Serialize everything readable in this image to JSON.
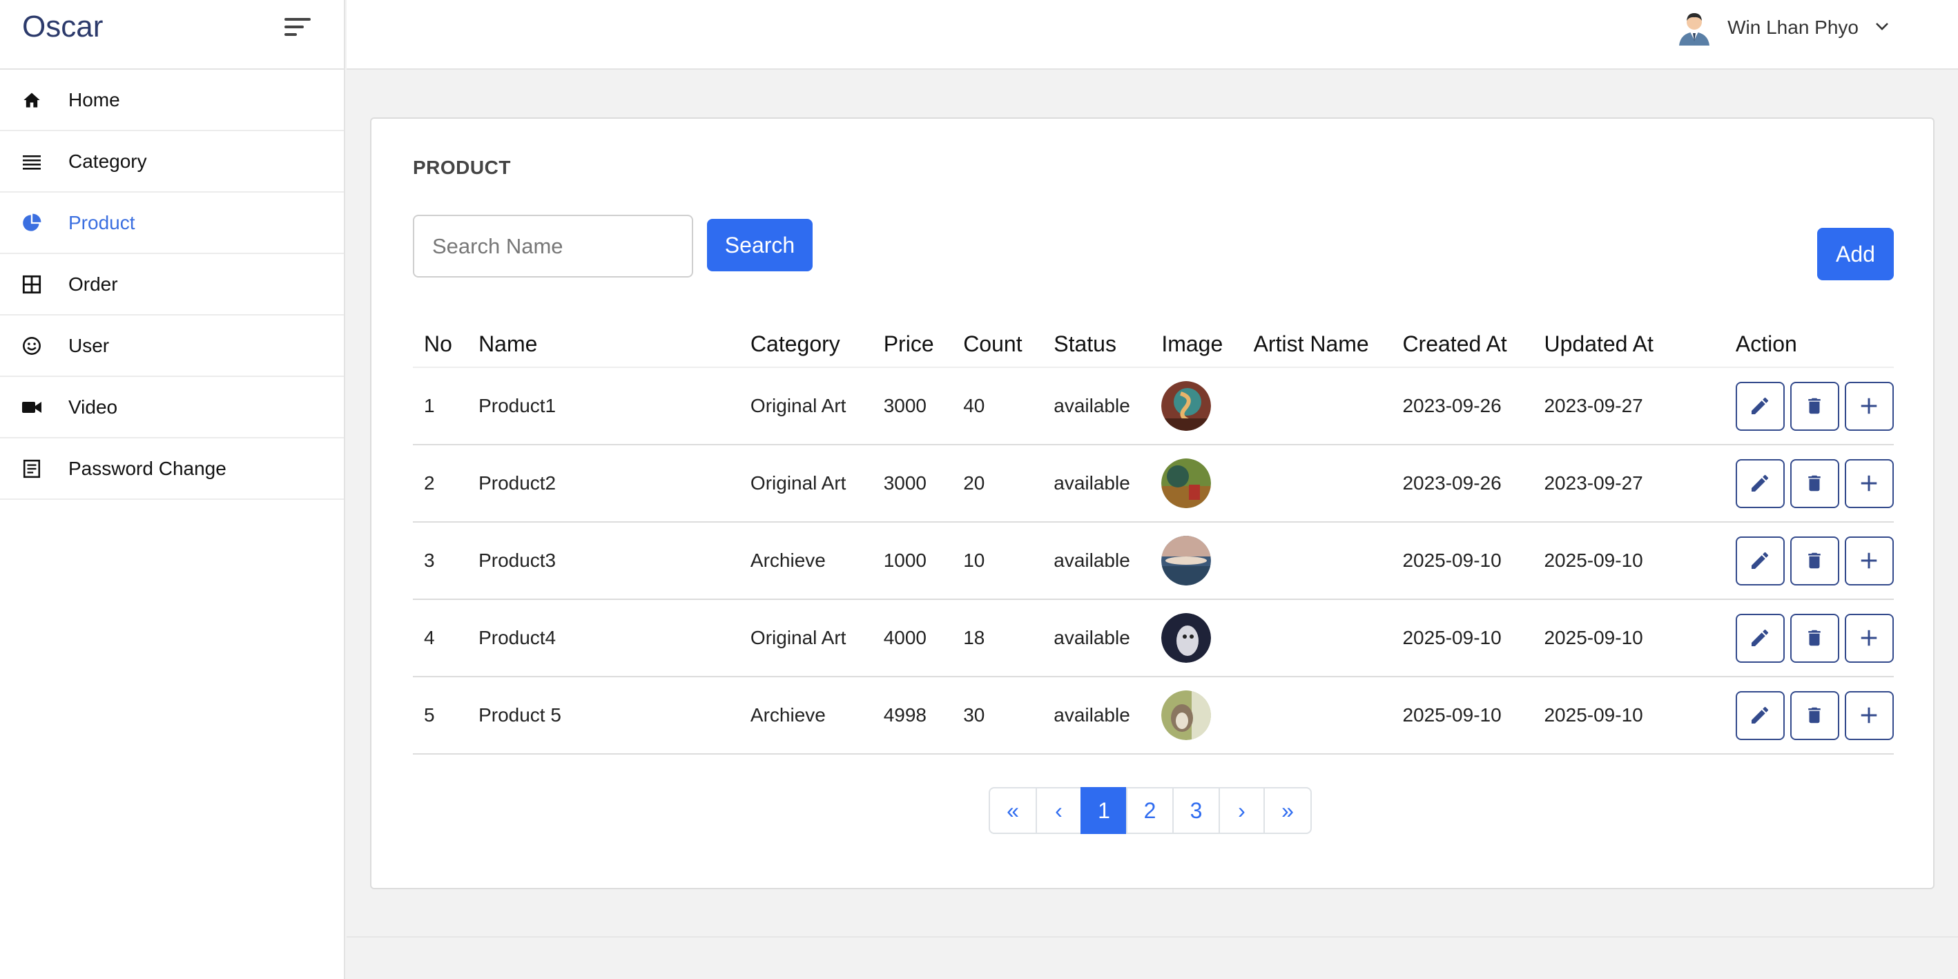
{
  "brand": {
    "name": "Oscar"
  },
  "sidebar": {
    "items": [
      {
        "label": "Home",
        "icon": "home-icon"
      },
      {
        "label": "Category",
        "icon": "list-icon"
      },
      {
        "label": "Product",
        "icon": "pie-chart-icon",
        "active": true
      },
      {
        "label": "Order",
        "icon": "grid-icon"
      },
      {
        "label": "User",
        "icon": "smile-icon"
      },
      {
        "label": "Video",
        "icon": "video-camera-icon"
      },
      {
        "label": "Password Change",
        "icon": "document-icon"
      }
    ]
  },
  "topbar": {
    "user_name": "Win Lhan Phyo"
  },
  "page": {
    "title": "PRODUCT",
    "search_placeholder": "Search Name",
    "search_value": "",
    "search_label": "Search",
    "add_label": "Add"
  },
  "table": {
    "headers": [
      "No",
      "Name",
      "Category",
      "Price",
      "Count",
      "Status",
      "Image",
      "Artist Name",
      "Created At",
      "Updated At",
      "Action"
    ],
    "rows": [
      {
        "no": "1",
        "name": "Product1",
        "category": "Original Art",
        "price": "3000",
        "count": "40",
        "status": "available",
        "artist": "",
        "created": "2023-09-26",
        "updated": "2023-09-27"
      },
      {
        "no": "2",
        "name": "Product2",
        "category": "Original Art",
        "price": "3000",
        "count": "20",
        "status": "available",
        "artist": "",
        "created": "2023-09-26",
        "updated": "2023-09-27"
      },
      {
        "no": "3",
        "name": "Product3",
        "category": "Archieve",
        "price": "1000",
        "count": "10",
        "status": "available",
        "artist": "",
        "created": "2025-09-10",
        "updated": "2025-09-10"
      },
      {
        "no": "4",
        "name": "Product4",
        "category": "Original Art",
        "price": "4000",
        "count": "18",
        "status": "available",
        "artist": "",
        "created": "2025-09-10",
        "updated": "2025-09-10"
      },
      {
        "no": "5",
        "name": "Product 5",
        "category": "Archieve",
        "price": "4998",
        "count": "30",
        "status": "available",
        "artist": "",
        "created": "2025-09-10",
        "updated": "2025-09-10"
      }
    ]
  },
  "pagination": {
    "first": "«",
    "prev": "‹",
    "pages": [
      "1",
      "2",
      "3"
    ],
    "current": "1",
    "next": "›",
    "last": "»"
  },
  "colors": {
    "primary": "#2f6cf0",
    "action_border": "#334a8c",
    "brand": "#2c3a6b",
    "active_nav": "#3b6fe0"
  }
}
